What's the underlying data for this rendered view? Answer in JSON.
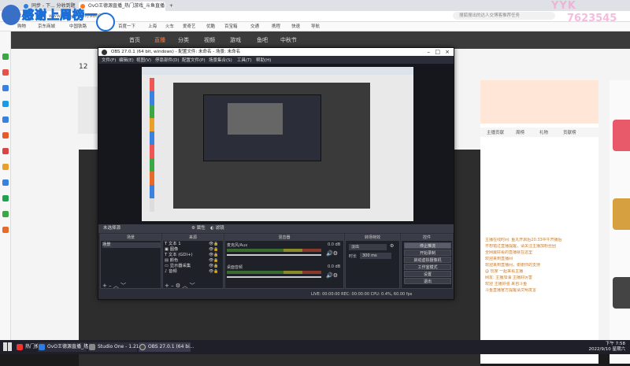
{
  "browser": {
    "tabs": [
      {
        "label": "同步 - 下... 分收到题",
        "color": "#2f7de1"
      },
      {
        "label": "OvO王德源直播_热门游戏_斗鱼直播",
        "color": "#ff7a1a"
      },
      {
        "label": "+",
        "color": ""
      }
    ],
    "url": "www.douyu.com/9805714",
    "search_placeholder": "搜狐搜出的达人交博客推荐任务",
    "bookmarks": [
      "购物",
      "京东商城",
      "中国铁路",
      "唐朝",
      "百度一下",
      "上海",
      "火车",
      "爱奇艺",
      "优酷",
      "百宝箱",
      "交通",
      "携程",
      "快速",
      "导航"
    ]
  },
  "site": {
    "nav": [
      "首页",
      "直播",
      "分类",
      "视频",
      "游戏",
      "鱼吧",
      "中秋节"
    ],
    "active_nav": "直播",
    "follow_count": "12",
    "right_panel": {
      "tabs": [
        "主播贡献",
        "周榜",
        "礼物",
        "贡献榜"
      ],
      "chat": [
        "主播在线时间: 鱼丸开启后20:33中午开播后",
        "不想错过直播提醒，请关注主播加粉丝团",
        "全网最好看的直播就在这里",
        "欢迎来到直播间",
        "欢迎来到直播间，谢谢你的支持",
        "@ 玩家 一起来看主播",
        "网友: 主播加油 主播好厉害",
        "欢迎 主播好强 来自斗鱼",
        "斗鱼直播官方提醒请文明发言"
      ]
    }
  },
  "overlay": {
    "banner": "感谢上周榜一",
    "watermark1": "YYK",
    "watermark2": "7623545"
  },
  "obs": {
    "title": "OBS 27.0.1 (64 bit, windows) - 配置文件: 未命名 - 场景: 未命名",
    "menu": [
      "文件(F)",
      "编辑(E)",
      "视图(V)",
      "停靠部件(D)",
      "配置文件(P)",
      "场景集合(S)",
      "工具(T)",
      "帮助(H)"
    ],
    "source_bar": "未选择源",
    "source_bar_props": "属性",
    "source_bar_filters": "滤镜",
    "panels": {
      "scenes_title": "场景",
      "sources_title": "来源",
      "mixer_title": "混音器",
      "transitions_title": "转场特效",
      "controls_title": "控件"
    },
    "scenes": [
      "场景"
    ],
    "sources": [
      "文本 1",
      "图像",
      "文本 (GDI+)",
      "颜色",
      "显示器采集",
      "音频"
    ],
    "mixer": [
      {
        "name": "麦克风/Aux",
        "db": "0.0 dB"
      },
      {
        "name": "桌面音频",
        "db": "0.0 dB"
      }
    ],
    "transition": {
      "type": "淡出",
      "duration_label": "时长",
      "duration": "300 ms"
    },
    "controls": [
      "停止推流",
      "开始录制",
      "启动虚拟摄像机",
      "工作室模式",
      "设置",
      "退出"
    ],
    "status": "LIVE: 00:00:00    REC: 00:00:00    CPU: 0.4%, 60.00 fps"
  },
  "taskbar": {
    "items": [
      {
        "label": "热门推荐 雷火军团推荐 - 回区",
        "color": "#e33"
      },
      {
        "label": "OvO王德源直播_热...",
        "color": "#2f7de1"
      },
      {
        "label": "Studio One - 1.21",
        "color": "#888"
      },
      {
        "label": "OBS 27.0.1 (64 bi...",
        "color": "#444"
      }
    ],
    "time": "下午 7:58",
    "date": "2022/9/10 星期六"
  },
  "colors": {
    "accent": "#ff7a3c",
    "obs_bg": "#2b2e38"
  }
}
